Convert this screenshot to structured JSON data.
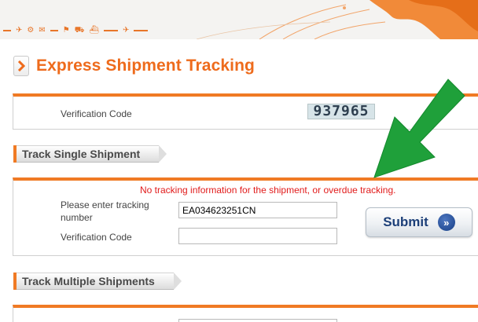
{
  "banner": {
    "icon_glyphs": [
      "✈",
      "⚙",
      "✉",
      "⚑",
      "⛟",
      "⛴",
      "✈"
    ]
  },
  "page": {
    "title": "Express Shipment Tracking"
  },
  "verification_box": {
    "label": "Verification Code",
    "captcha_value": "937965"
  },
  "single_section": {
    "tab_label": "Track Single Shipment",
    "error_message": "No tracking information for the shipment, or overdue tracking.",
    "tracking_label": "Please enter tracking number",
    "tracking_value": "EA034623251CN",
    "verification_label": "Verification Code",
    "verification_value": "",
    "submit_label": "Submit",
    "submit_icon": "»"
  },
  "multiple_section": {
    "tab_label": "Track Multiple Shipments"
  },
  "colors": {
    "accent": "#f07a24",
    "title": "#ee6b1c",
    "error": "#e11b1b",
    "annotation_arrow": "#1fa03a"
  }
}
